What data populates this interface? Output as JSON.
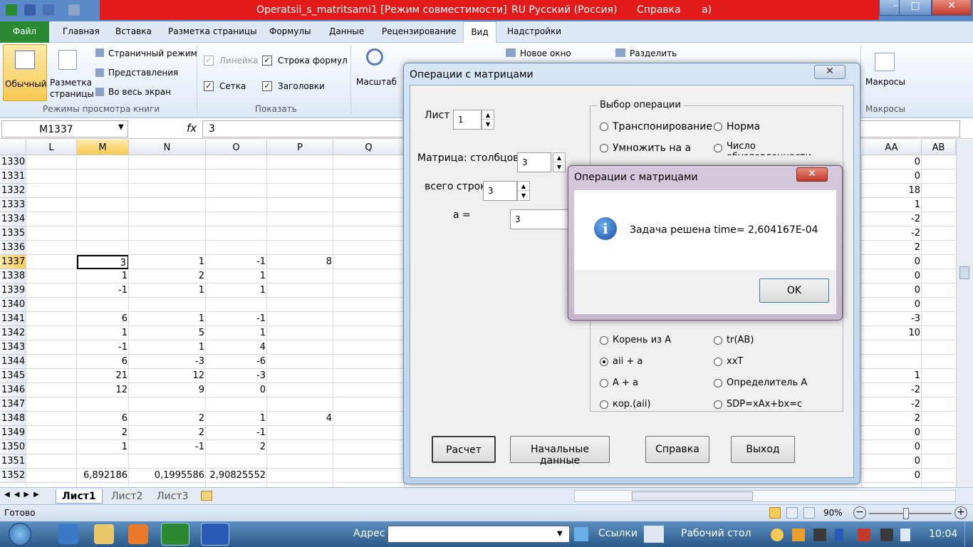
{
  "window": {
    "title": "Operatsii_s_matritsami1  [Режим совместимости] - ",
    "title_suffix": "a)",
    "language": "RU Русский (Россия)",
    "help": "Справка",
    "min": "–",
    "max": "□",
    "close": "✕"
  },
  "ribbon_tabs": [
    "Файл",
    "Главная",
    "Вставка",
    "Разметка страницы",
    "Формулы",
    "Данные",
    "Рецензирование",
    "Вид",
    "Надстройки"
  ],
  "ribbon": {
    "normal": "Обычный",
    "page_layout": "Разметка страницы",
    "page_mode": "Страничный режим",
    "views": "Представления",
    "fullscreen": "Во весь экран",
    "group_views": "Режимы просмотра книги",
    "ruler": "Линейка",
    "formula_bar": "Строка формул",
    "grid": "Сетка",
    "headings": "Заголовки",
    "group_show": "Показать",
    "zoom": "Масштаб",
    "new_window": "Новое окно",
    "split": "Разделить",
    "macros": "Макросы",
    "group_macros": "Макросы"
  },
  "formula": {
    "namebox": "M1337",
    "fx": "fx",
    "value": "3"
  },
  "columns": [
    "L",
    "M",
    "N",
    "O",
    "P",
    "Q",
    "AA",
    "AB"
  ],
  "rows": [
    {
      "n": "1330",
      "M": "",
      "N": "",
      "O": "",
      "P": "",
      "AA": "0"
    },
    {
      "n": "1331",
      "M": "",
      "N": "",
      "O": "",
      "P": "",
      "AA": "0"
    },
    {
      "n": "1332",
      "M": "",
      "N": "",
      "O": "",
      "P": "",
      "AA": "18"
    },
    {
      "n": "1333",
      "M": "",
      "N": "",
      "O": "",
      "P": "",
      "AA": "1"
    },
    {
      "n": "1334",
      "M": "",
      "N": "",
      "O": "",
      "P": "",
      "AA": "-2"
    },
    {
      "n": "1335",
      "M": "",
      "N": "",
      "O": "",
      "P": "",
      "AA": "-2"
    },
    {
      "n": "1336",
      "M": "",
      "N": "",
      "O": "",
      "P": "",
      "AA": "2"
    },
    {
      "n": "1337",
      "M": "3",
      "N": "1",
      "O": "-1",
      "P": "8",
      "AA": "0"
    },
    {
      "n": "1338",
      "M": "1",
      "N": "2",
      "O": "1",
      "P": "",
      "AA": "0"
    },
    {
      "n": "1339",
      "M": "-1",
      "N": "1",
      "O": "1",
      "P": "",
      "AA": "0"
    },
    {
      "n": "1340",
      "M": "",
      "N": "",
      "O": "",
      "P": "",
      "AA": "0"
    },
    {
      "n": "1341",
      "M": "6",
      "N": "1",
      "O": "-1",
      "P": "",
      "AA": "-3"
    },
    {
      "n": "1342",
      "M": "1",
      "N": "5",
      "O": "1",
      "P": "",
      "AA": "10"
    },
    {
      "n": "1343",
      "M": "-1",
      "N": "1",
      "O": "4",
      "P": "",
      "AA": ""
    },
    {
      "n": "1344",
      "M": "6",
      "N": "-3",
      "O": "-6",
      "P": "",
      "AA": ""
    },
    {
      "n": "1345",
      "M": "21",
      "N": "12",
      "O": "-3",
      "P": "",
      "AA": "1"
    },
    {
      "n": "1346",
      "M": "12",
      "N": "9",
      "O": "0",
      "P": "",
      "AA": "-2"
    },
    {
      "n": "1347",
      "M": "",
      "N": "",
      "O": "",
      "P": "",
      "AA": "-2"
    },
    {
      "n": "1348",
      "M": "6",
      "N": "2",
      "O": "1",
      "P": "4",
      "AA": "2"
    },
    {
      "n": "1349",
      "M": "2",
      "N": "2",
      "O": "-1",
      "P": "",
      "AA": "0"
    },
    {
      "n": "1350",
      "M": "1",
      "N": "-1",
      "O": "2",
      "P": "",
      "AA": "0"
    },
    {
      "n": "1351",
      "M": "",
      "N": "",
      "O": "",
      "P": "",
      "AA": "0"
    },
    {
      "n": "1352",
      "M": "6,892186",
      "N": "0,1995586",
      "O": "2,90825552",
      "P": "",
      "AA": "0"
    }
  ],
  "sheets": [
    "Лист1",
    "Лист2",
    "Лист3"
  ],
  "status": {
    "ready": "Готово",
    "zoom": "90%"
  },
  "form": {
    "title": "Операции с матрицами",
    "sheet_label": "Лист",
    "sheet_value": "1",
    "cols_label": "Матрица: столбцов",
    "cols_value": "3",
    "rows_label": "всего строк",
    "rows_value": "3",
    "a_label": "a =",
    "a_value": "3",
    "op_group": "Выбор операции",
    "left_options": [
      "Транспонирование",
      "Умножить на а"
    ],
    "right_options": [
      "Норма",
      "Число обусловленности"
    ],
    "bottom_left": [
      "Корень из А",
      "aii + a",
      "A + a",
      "кор.(aii)"
    ],
    "bottom_right": [
      "tr(AB)",
      "xxT",
      "Определитель А",
      "SDP=xAx+bx=c"
    ],
    "selected": "aii + a",
    "buttons": [
      "Расчет",
      "Начальные данные",
      "Справка",
      "Выход"
    ]
  },
  "message": {
    "title": "Операции с матрицами",
    "text": "Задача решена  time= 2,604167E-04",
    "ok": "OK"
  },
  "taskbar": {
    "address": "Адрес",
    "links": "Ссылки",
    "desktop": "Рабочий стол",
    "time": "10:04"
  }
}
